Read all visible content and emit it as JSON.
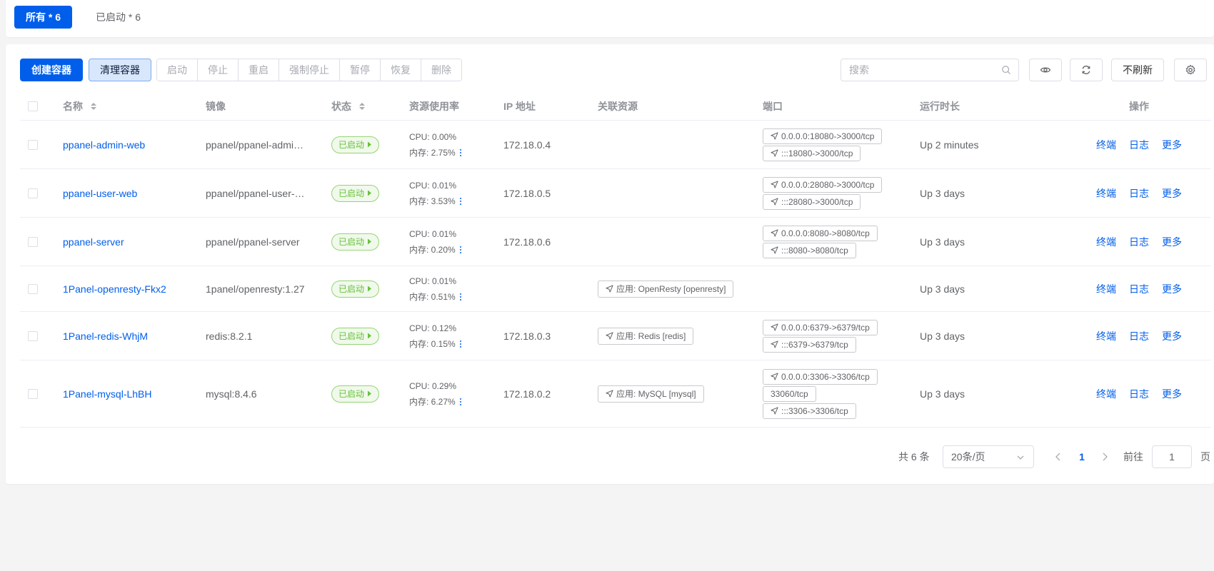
{
  "filter_tabs": [
    {
      "label": "所有 * 6",
      "active": true
    },
    {
      "label": "已启动 * 6",
      "active": false
    }
  ],
  "toolbar": {
    "create_label": "创建容器",
    "clean_label": "清理容器",
    "actions": [
      "启动",
      "停止",
      "重启",
      "强制停止",
      "暂停",
      "恢复",
      "删除"
    ],
    "search_placeholder": "搜索",
    "refresh_mode_label": "不刷新",
    "icons": {
      "search": "search-icon",
      "view": "eye-icon",
      "refresh": "refresh-icon",
      "settings": "gear-icon"
    }
  },
  "table": {
    "headers": {
      "name": "名称",
      "image": "镜像",
      "status": "状态",
      "resource": "资源使用率",
      "ip": "IP 地址",
      "related": "关联资源",
      "ports": "端口",
      "uptime": "运行时长",
      "actions": "操作"
    },
    "rows": [
      {
        "name": "ppanel-admin-web",
        "image": "ppanel/ppanel-admin-web",
        "status": "已启动",
        "cpu": "CPU: 0.00%",
        "mem": "内存: 2.75%",
        "ip": "172.18.0.4",
        "related": [],
        "ports": [
          {
            "text": "0.0.0.0:18080->3000/tcp",
            "icon": true
          },
          {
            "text": ":::18080->3000/tcp",
            "icon": true
          }
        ],
        "uptime": "Up 2 minutes"
      },
      {
        "name": "ppanel-user-web",
        "image": "ppanel/ppanel-user-web",
        "status": "已启动",
        "cpu": "CPU: 0.01%",
        "mem": "内存: 3.53%",
        "ip": "172.18.0.5",
        "related": [],
        "ports": [
          {
            "text": "0.0.0.0:28080->3000/tcp",
            "icon": true
          },
          {
            "text": ":::28080->3000/tcp",
            "icon": true
          }
        ],
        "uptime": "Up 3 days"
      },
      {
        "name": "ppanel-server",
        "image": "ppanel/ppanel-server",
        "status": "已启动",
        "cpu": "CPU: 0.01%",
        "mem": "内存: 0.20%",
        "ip": "172.18.0.6",
        "related": [],
        "ports": [
          {
            "text": "0.0.0.0:8080->8080/tcp",
            "icon": true
          },
          {
            "text": ":::8080->8080/tcp",
            "icon": true
          }
        ],
        "uptime": "Up 3 days"
      },
      {
        "name": "1Panel-openresty-Fkx2",
        "image": "1panel/openresty:1.27",
        "status": "已启动",
        "cpu": "CPU: 0.01%",
        "mem": "内存: 0.51%",
        "ip": "",
        "related": [
          "应用: OpenResty [openresty]"
        ],
        "ports": [],
        "uptime": "Up 3 days"
      },
      {
        "name": "1Panel-redis-WhjM",
        "image": "redis:8.2.1",
        "status": "已启动",
        "cpu": "CPU: 0.12%",
        "mem": "内存: 0.15%",
        "ip": "172.18.0.3",
        "related": [
          "应用: Redis [redis]"
        ],
        "ports": [
          {
            "text": "0.0.0.0:6379->6379/tcp",
            "icon": true
          },
          {
            "text": ":::6379->6379/tcp",
            "icon": true
          }
        ],
        "uptime": "Up 3 days"
      },
      {
        "name": "1Panel-mysql-LhBH",
        "image": "mysql:8.4.6",
        "status": "已启动",
        "cpu": "CPU: 0.29%",
        "mem": "内存: 6.27%",
        "ip": "172.18.0.2",
        "related": [
          "应用: MySQL [mysql]"
        ],
        "ports": [
          {
            "text": "0.0.0.0:3306->3306/tcp",
            "icon": true
          },
          {
            "text": "33060/tcp",
            "icon": false
          },
          {
            "text": ":::3306->3306/tcp",
            "icon": true
          }
        ],
        "uptime": "Up 3 days"
      }
    ],
    "row_actions": [
      "终端",
      "日志",
      "更多"
    ]
  },
  "pagination": {
    "total_label": "共 6 条",
    "page_size": "20条/页",
    "current_page": "1",
    "goto_label": "前往",
    "goto_value": "1",
    "page_suffix": "页"
  },
  "colors": {
    "primary": "#005eeb",
    "success": "#67c23a",
    "border": "#dcdfe6"
  }
}
